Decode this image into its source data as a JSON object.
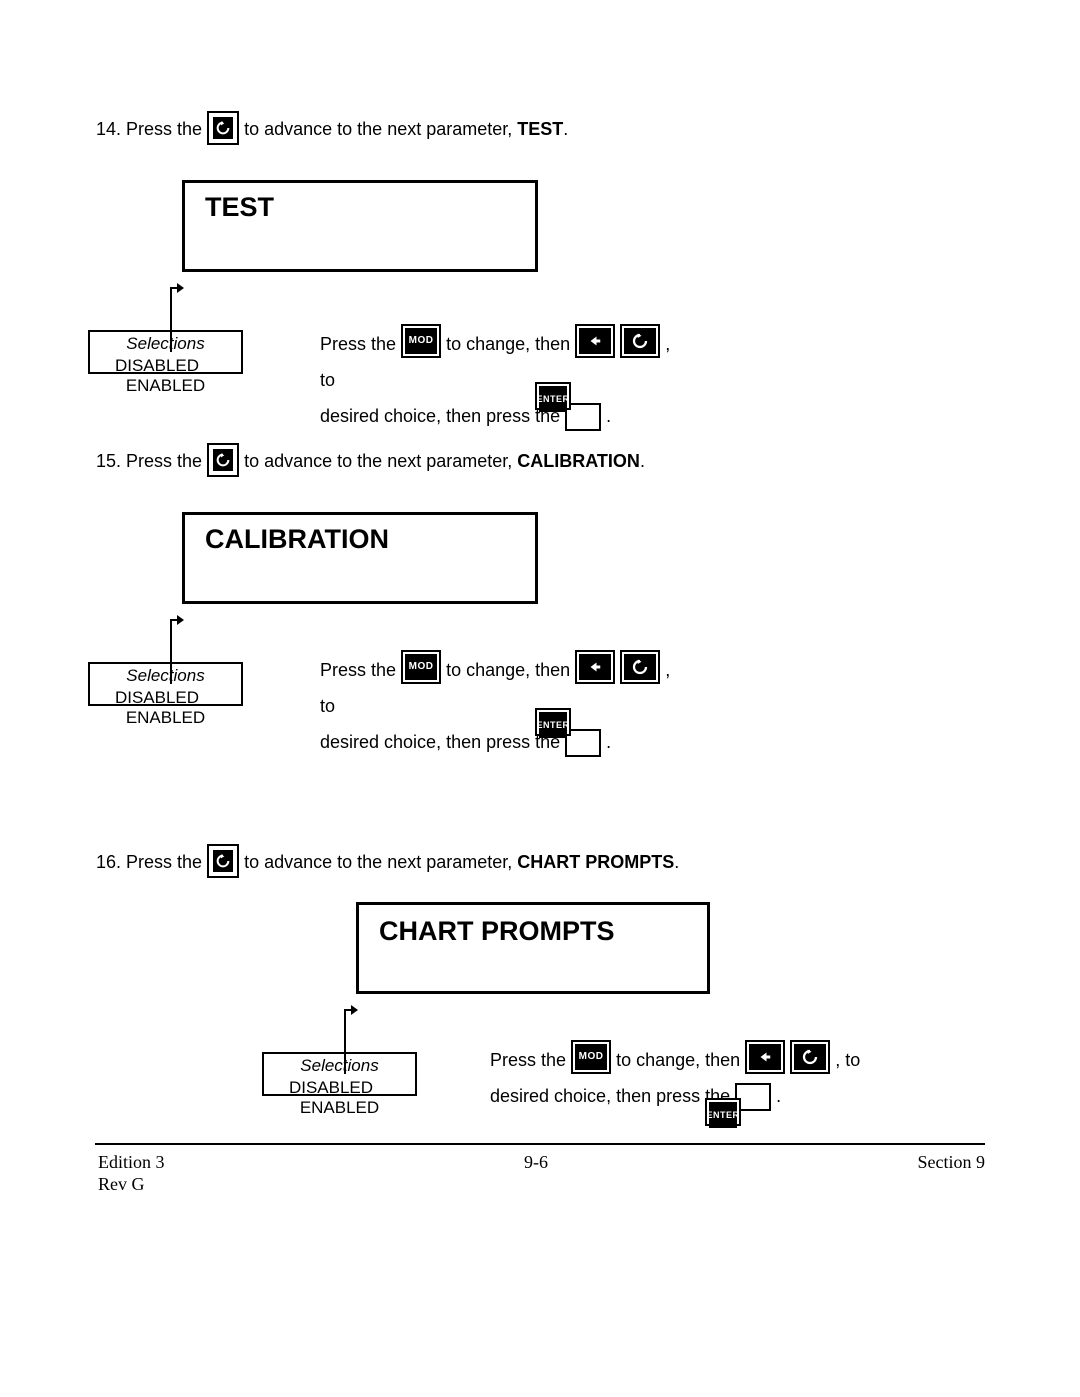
{
  "steps": {
    "s14": {
      "num": "14.",
      "pre": "  Press the ",
      "post": " to advance to the next parameter, ",
      "param": "TEST",
      "end": "."
    },
    "s15": {
      "num": "15.",
      "pre": "  Press the ",
      "post": " to advance to the next parameter, ",
      "param": "CALIBRATION",
      "end": "."
    },
    "s16": {
      "num": "16.",
      "pre": "  Press the ",
      "post": " to advance to the next parameter, ",
      "param": "CHART PROMPTS",
      "end": "."
    }
  },
  "displays": {
    "test": "TEST",
    "calibration": "CALIBRATION",
    "chart": "CHART PROMPTS"
  },
  "selections": {
    "title": "Selections",
    "opts": "DISABLED ENABLED"
  },
  "instruction": {
    "l1a": "Press  the ",
    "l1b": " to change, then ",
    "l1c": " ,  to",
    "l2a": "desired choice, then press the ",
    "l2b": " .",
    "mod": "MOD",
    "enter": "ENTER"
  },
  "footer": {
    "edition": "Edition 3",
    "rev": "Rev G",
    "page": "9-6",
    "section": "Section 9"
  }
}
